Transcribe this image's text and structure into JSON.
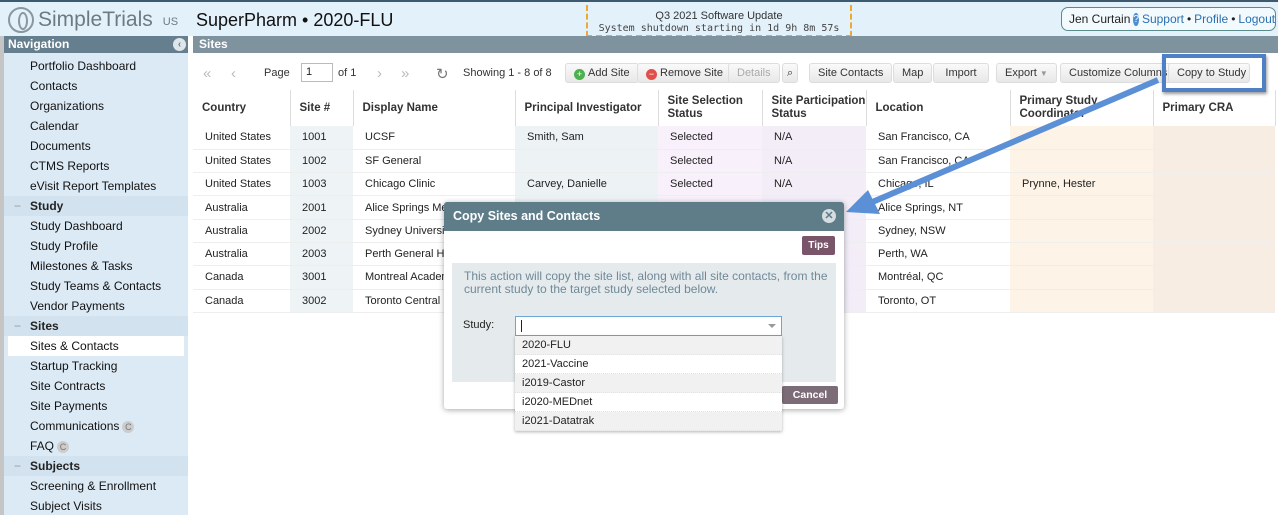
{
  "header": {
    "logo": "SimpleTrials",
    "region": "US",
    "study_title": "SuperPharm • 2020-FLU",
    "notice": {
      "title": "Q3 2021 Software Update",
      "message": "System shutdown starting in 1d 9h 8m 57s"
    },
    "user": {
      "name": "Jen Curtain",
      "support": "Support",
      "profile": "Profile",
      "logout": "Logout",
      "sep": "•"
    }
  },
  "sidebar": {
    "title": "Navigation",
    "top_items": [
      "Portfolio Dashboard",
      "Contacts",
      "Organizations",
      "Calendar",
      "Documents",
      "CTMS Reports",
      "eVisit Report Templates"
    ],
    "sections": [
      {
        "label": "Study",
        "items": [
          "Study Dashboard",
          "Study Profile",
          "Milestones & Tasks",
          "Study Teams & Contacts",
          "Vendor Payments"
        ]
      },
      {
        "label": "Sites",
        "items": [
          "Sites & Contacts",
          "Startup Tracking",
          "Site Contracts",
          "Site Payments",
          "Communications",
          "FAQ"
        ],
        "active": "Sites & Contacts"
      },
      {
        "label": "Subjects",
        "items": [
          "Screening & Enrollment",
          "Subject Visits"
        ]
      }
    ],
    "badge": "C"
  },
  "main": {
    "title": "Sites",
    "toolbar": {
      "page_label": "Page",
      "page_value": "1",
      "of_label": "of 1",
      "showing": "Showing 1 - 8 of 8",
      "add_site": "Add Site",
      "remove_site": "Remove Site",
      "details": "Details",
      "site_contacts": "Site Contacts",
      "map": "Map",
      "import": "Import",
      "export": "Export",
      "customize_columns": "Customize Columns",
      "copy_to_study": "Copy to Study"
    },
    "columns": [
      "Country",
      "Site #",
      "Display Name",
      "Principal Investigator",
      "Site Selection Status",
      "Site Participation Status",
      "Location",
      "Primary Study Coordinator",
      "Primary CRA"
    ],
    "rows": [
      [
        "United States",
        "1001",
        "UCSF",
        "Smith, Sam",
        "Selected",
        "N/A",
        "San Francisco, CA",
        "",
        ""
      ],
      [
        "United States",
        "1002",
        "SF General",
        "",
        "Selected",
        "N/A",
        "San Francisco, CA",
        "",
        ""
      ],
      [
        "United States",
        "1003",
        "Chicago Clinic",
        "Carvey, Danielle",
        "Selected",
        "N/A",
        "Chicago, IL",
        "Prynne, Hester",
        ""
      ],
      [
        "Australia",
        "2001",
        "Alice Springs Medical",
        "",
        "",
        "",
        "Alice Springs, NT",
        "",
        ""
      ],
      [
        "Australia",
        "2002",
        "Sydney University",
        "",
        "",
        "",
        "Sydney, NSW",
        "",
        ""
      ],
      [
        "Australia",
        "2003",
        "Perth General Hospital",
        "",
        "",
        "",
        "Perth, WA",
        "",
        ""
      ],
      [
        "Canada",
        "3001",
        "Montreal Academic",
        "",
        "",
        "",
        "Montréal, QC",
        "",
        ""
      ],
      [
        "Canada",
        "3002",
        "Toronto Central Hospital",
        "",
        "",
        "",
        "Toronto, OT",
        "",
        ""
      ]
    ]
  },
  "dialog": {
    "title": "Copy Sites and Contacts",
    "tips": "Tips",
    "info": "This action will copy the site list, along with all site contacts, from the current study to the target study selected below.",
    "study_label": "Study:",
    "study_value": "",
    "options": [
      "2020-FLU",
      "2021-Vaccine",
      "i2019-Castor",
      "i2020-MEDnet",
      "i2021-Datatrak"
    ],
    "cancel": "Cancel"
  },
  "colors": {
    "accent": "#5f7c89",
    "annotation": "#4f7fc4",
    "notice_border": "#f0a830"
  }
}
